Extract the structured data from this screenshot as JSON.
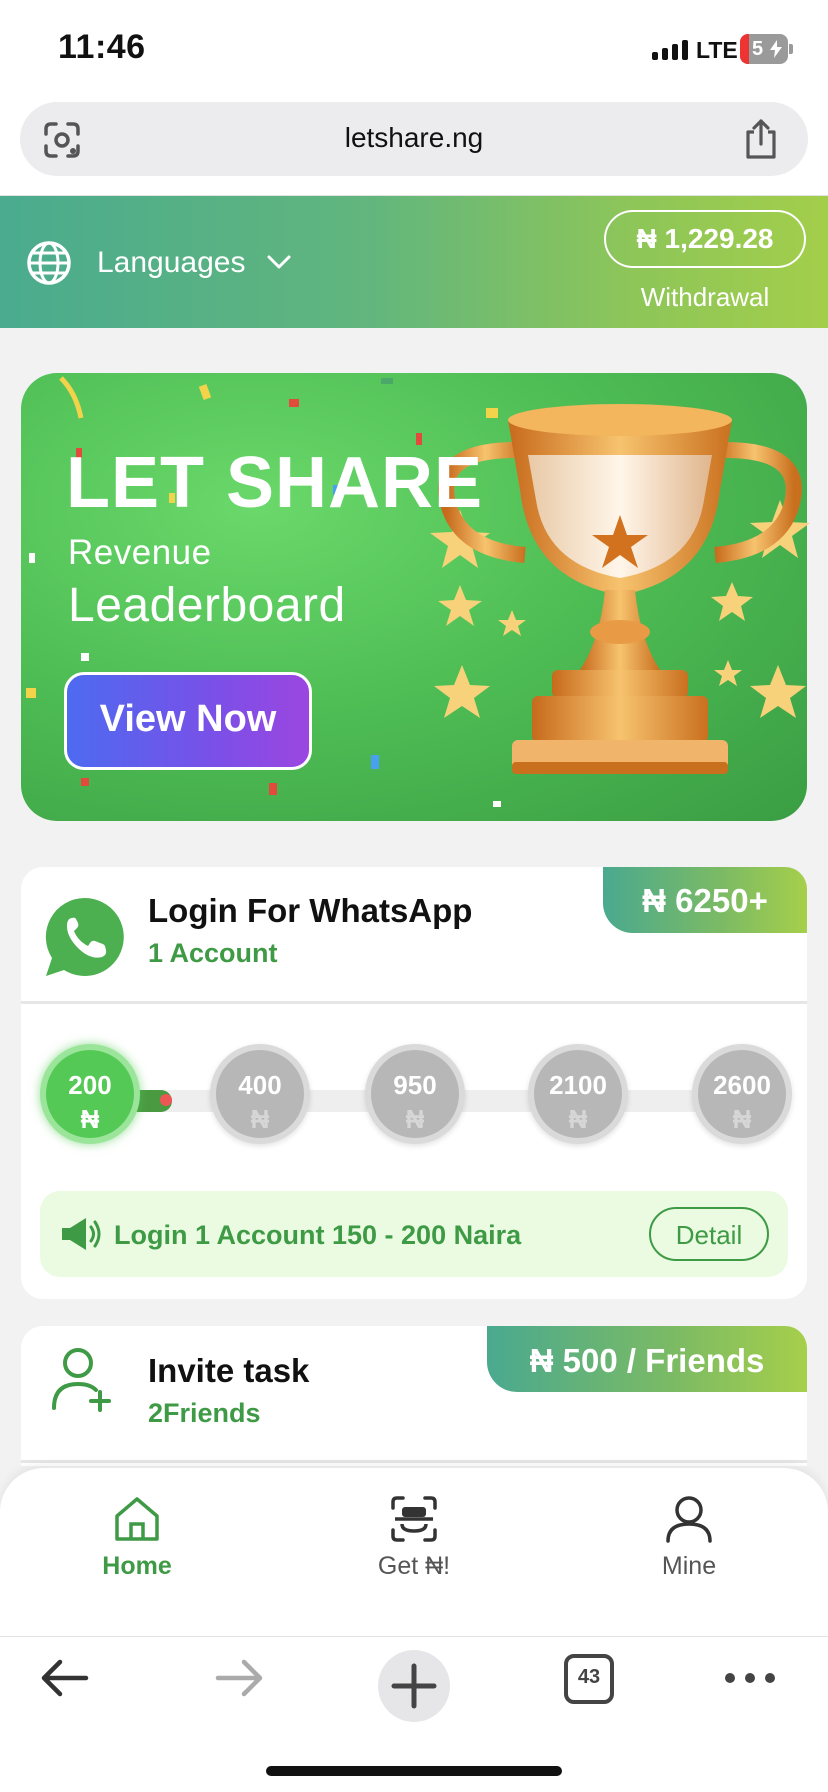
{
  "status_bar": {
    "time": "11:46",
    "network": "LTE",
    "battery": "5"
  },
  "browser": {
    "url": "letshare.ng",
    "tab_count": "43"
  },
  "header": {
    "languages_label": "Languages",
    "balance": "₦ 1,229.28",
    "withdraw_label": "Withdrawal"
  },
  "banner": {
    "title": "LET SHARE",
    "subtitle_small": "Revenue",
    "subtitle_large": "Leaderboard",
    "button_label": "View Now"
  },
  "whatsapp_task": {
    "title": "Login For WhatsApp",
    "subtitle": "1 Account",
    "reward": "₦ 6250+",
    "currency_symbol": "₦",
    "milestones": [
      "200",
      "400",
      "950",
      "2100",
      "2600"
    ],
    "notice": "Login 1 Account 150 - 200 Naira",
    "detail_label": "Detail"
  },
  "invite_task": {
    "title": "Invite task",
    "subtitle": "2Friends",
    "reward": "₦ 500 / Friends"
  },
  "bottom_nav": {
    "items": [
      {
        "label": "Home",
        "icon": "home-icon",
        "active": true
      },
      {
        "label": "Get ₦!",
        "icon": "scan-icon",
        "active": false
      },
      {
        "label": "Mine",
        "icon": "user-icon",
        "active": false
      }
    ]
  },
  "colors": {
    "accent_green": "#3f9a45",
    "header_gradient_start": "#4aab8e",
    "header_gradient_end": "#a3ce4a",
    "button_gradient_start": "#4d6bf0",
    "button_gradient_end": "#9c46e0"
  }
}
